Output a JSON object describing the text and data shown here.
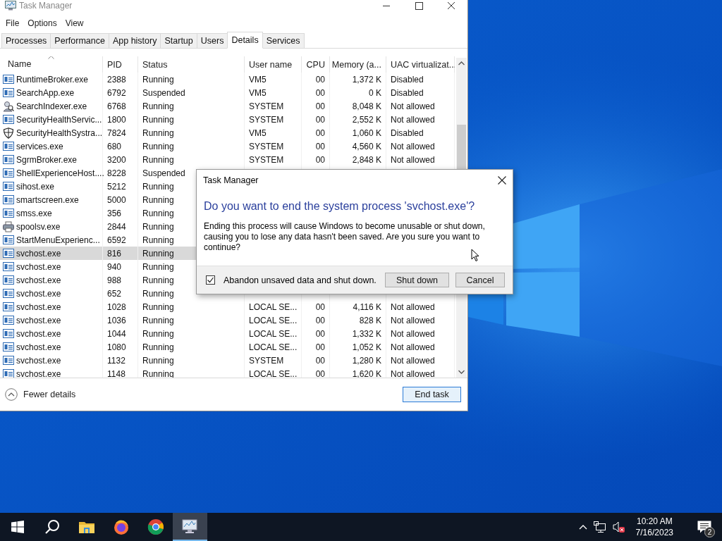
{
  "window": {
    "title": "Task Manager"
  },
  "menu": [
    "File",
    "Options",
    "View"
  ],
  "tabs": [
    {
      "label": "Processes",
      "selected": false
    },
    {
      "label": "Performance",
      "selected": false
    },
    {
      "label": "App history",
      "selected": false
    },
    {
      "label": "Startup",
      "selected": false
    },
    {
      "label": "Users",
      "selected": false
    },
    {
      "label": "Details",
      "selected": true
    },
    {
      "label": "Services",
      "selected": false
    }
  ],
  "table": {
    "columns": [
      {
        "label": "Name",
        "sorted": true
      },
      {
        "label": "PID",
        "sorted": false
      },
      {
        "label": "Status",
        "sorted": false
      },
      {
        "label": "User name",
        "sorted": false
      },
      {
        "label": "CPU",
        "sorted": false
      },
      {
        "label": "Memory (a...",
        "sorted": false
      },
      {
        "label": "UAC virtualizat...",
        "sorted": false
      }
    ],
    "rows": [
      {
        "kind": "app",
        "name": "RuntimeBroker.exe",
        "pid": "2388",
        "status": "Running",
        "user": "VM5",
        "cpu": "00",
        "memory": "1,372 K",
        "uac": "Disabled",
        "selected": false
      },
      {
        "kind": "app",
        "name": "SearchApp.exe",
        "pid": "6792",
        "status": "Suspended",
        "user": "VM5",
        "cpu": "00",
        "memory": "0 K",
        "uac": "Disabled",
        "selected": false
      },
      {
        "kind": "indexer",
        "name": "SearchIndexer.exe",
        "pid": "6768",
        "status": "Running",
        "user": "SYSTEM",
        "cpu": "00",
        "memory": "8,048 K",
        "uac": "Not allowed",
        "selected": false
      },
      {
        "kind": "app",
        "name": "SecurityHealthServic...",
        "pid": "1800",
        "status": "Running",
        "user": "SYSTEM",
        "cpu": "00",
        "memory": "2,552 K",
        "uac": "Not allowed",
        "selected": false
      },
      {
        "kind": "shield",
        "name": "SecurityHealthSystra...",
        "pid": "7824",
        "status": "Running",
        "user": "VM5",
        "cpu": "00",
        "memory": "1,060 K",
        "uac": "Disabled",
        "selected": false
      },
      {
        "kind": "app",
        "name": "services.exe",
        "pid": "680",
        "status": "Running",
        "user": "SYSTEM",
        "cpu": "00",
        "memory": "4,560 K",
        "uac": "Not allowed",
        "selected": false
      },
      {
        "kind": "app",
        "name": "SgrmBroker.exe",
        "pid": "3200",
        "status": "Running",
        "user": "SYSTEM",
        "cpu": "00",
        "memory": "2,848 K",
        "uac": "Not allowed",
        "selected": false
      },
      {
        "kind": "app",
        "name": "ShellExperienceHost....",
        "pid": "8228",
        "status": "Suspended",
        "selected": false
      },
      {
        "kind": "app",
        "name": "sihost.exe",
        "pid": "5212",
        "status": "Running",
        "selected": false
      },
      {
        "kind": "app",
        "name": "smartscreen.exe",
        "pid": "5000",
        "status": "Running",
        "selected": false
      },
      {
        "kind": "app",
        "name": "smss.exe",
        "pid": "356",
        "status": "Running",
        "selected": false
      },
      {
        "kind": "printer",
        "name": "spoolsv.exe",
        "pid": "2844",
        "status": "Running",
        "selected": false
      },
      {
        "kind": "app",
        "name": "StartMenuExperienc...",
        "pid": "6592",
        "status": "Running",
        "selected": false
      },
      {
        "kind": "app",
        "name": "svchost.exe",
        "pid": "816",
        "status": "Running",
        "selected": true
      },
      {
        "kind": "app",
        "name": "svchost.exe",
        "pid": "940",
        "status": "Running",
        "selected": false
      },
      {
        "kind": "app",
        "name": "svchost.exe",
        "pid": "988",
        "status": "Running",
        "selected": false
      },
      {
        "kind": "app",
        "name": "svchost.exe",
        "pid": "652",
        "status": "Running",
        "selected": false
      },
      {
        "kind": "app",
        "name": "svchost.exe",
        "pid": "1028",
        "status": "Running",
        "user": "LOCAL SE...",
        "cpu": "00",
        "memory": "4,116 K",
        "uac": "Not allowed",
        "selected": false
      },
      {
        "kind": "app",
        "name": "svchost.exe",
        "pid": "1036",
        "status": "Running",
        "user": "LOCAL SE...",
        "cpu": "00",
        "memory": "828 K",
        "uac": "Not allowed",
        "selected": false
      },
      {
        "kind": "app",
        "name": "svchost.exe",
        "pid": "1044",
        "status": "Running",
        "user": "LOCAL SE...",
        "cpu": "00",
        "memory": "1,332 K",
        "uac": "Not allowed",
        "selected": false
      },
      {
        "kind": "app",
        "name": "svchost.exe",
        "pid": "1080",
        "status": "Running",
        "user": "LOCAL SE...",
        "cpu": "00",
        "memory": "1,052 K",
        "uac": "Not allowed",
        "selected": false
      },
      {
        "kind": "app",
        "name": "svchost.exe",
        "pid": "1132",
        "status": "Running",
        "user": "SYSTEM",
        "cpu": "00",
        "memory": "1,280 K",
        "uac": "Not allowed",
        "selected": false
      },
      {
        "kind": "app",
        "name": "svchost.exe",
        "pid": "1148",
        "status": "Running",
        "user": "LOCAL SE...",
        "cpu": "00",
        "memory": "1,620 K",
        "uac": "Not allowed",
        "selected": false
      }
    ]
  },
  "footer": {
    "toggle": "Fewer details",
    "button": "End task"
  },
  "dialog": {
    "title": "Task Manager",
    "heading": "Do you want to end the system process 'svchost.exe'?",
    "message": "Ending this process will cause Windows to become unusable or shut down, causing you to lose any data hasn't been saved. Are you sure you want to continue?",
    "checkbox": {
      "label": "Abandon unsaved data and shut down.",
      "checked": true
    },
    "buttons": [
      "Shut down",
      "Cancel"
    ]
  },
  "taskbar": {
    "apps": [
      {
        "kind": "start",
        "active": false
      },
      {
        "kind": "search",
        "active": false
      },
      {
        "kind": "files",
        "active": false
      },
      {
        "kind": "firefox",
        "active": false
      },
      {
        "kind": "chrome",
        "active": false
      },
      {
        "kind": "taskmgr",
        "active": true
      }
    ],
    "tray": {
      "time": "10:20 AM",
      "date": "7/16/2023",
      "notifications": "2"
    }
  }
}
